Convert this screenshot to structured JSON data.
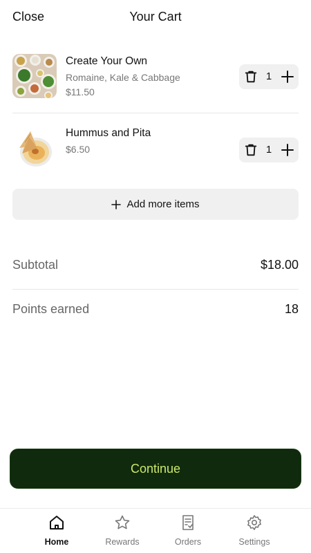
{
  "header": {
    "close_label": "Close",
    "title": "Your Cart"
  },
  "cart": {
    "items": [
      {
        "name": "Create Your Own",
        "description": "Romaine, Kale & Cabbage",
        "price": "$11.50",
        "quantity": "1",
        "image": "salad-bowls-image"
      },
      {
        "name": "Hummus and Pita",
        "description": "",
        "price": "$6.50",
        "quantity": "1",
        "image": "hummus-pita-image"
      }
    ],
    "add_more_label": "Add more items"
  },
  "summary": {
    "subtotal_label": "Subtotal",
    "subtotal_value": "$18.00",
    "points_label": "Points earned",
    "points_value": "18"
  },
  "continue_label": "Continue",
  "tabs": [
    {
      "label": "Home",
      "icon": "home-icon",
      "active": true
    },
    {
      "label": "Rewards",
      "icon": "star-icon",
      "active": false
    },
    {
      "label": "Orders",
      "icon": "receipt-icon",
      "active": false
    },
    {
      "label": "Settings",
      "icon": "gear-icon",
      "active": false
    }
  ],
  "colors": {
    "continue_bg": "#0f2a0c",
    "continue_text": "#cde96a",
    "stepper_bg": "#f0f0f0"
  }
}
